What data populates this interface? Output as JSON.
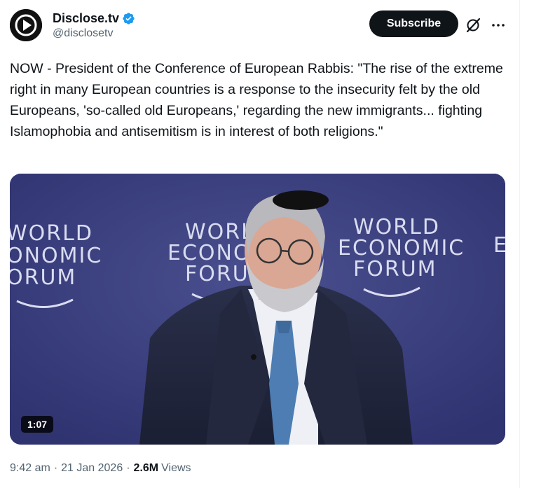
{
  "author": {
    "display_name": "Disclose.tv",
    "handle": "@disclosetv"
  },
  "header": {
    "subscribe_label": "Subscribe"
  },
  "icons": {
    "verified": "verified-badge-icon",
    "grok": "grok-icon",
    "more": "more-options-icon"
  },
  "colors": {
    "verified_blue": "#1d9bf0",
    "button_dark": "#0f1419",
    "secondary_text": "#536471",
    "stage_backdrop": "#393d7a"
  },
  "tweet": {
    "text": "NOW - President of the Conference of European Rabbis: \"The rise of the extreme right in many European countries is a response to the insecurity felt by the old Europeans, 'so-called old Europeans,' regarding the new immigrants... fighting Islamophobia and antisemitism is in interest of both religions.\""
  },
  "media": {
    "duration": "1:07",
    "backdrop_logo_lines": [
      "WORLD",
      "ECONOMIC",
      "FORUM"
    ],
    "backdrop_logo_partial_left": [
      "WORLD",
      "ONOMIC",
      "ORUM"
    ],
    "backdrop_logo_partial_right": "E"
  },
  "meta": {
    "time": "9:42 am",
    "separator": "·",
    "date": "21 Jan 2026",
    "views_count": "2.6M",
    "views_label": "Views"
  }
}
